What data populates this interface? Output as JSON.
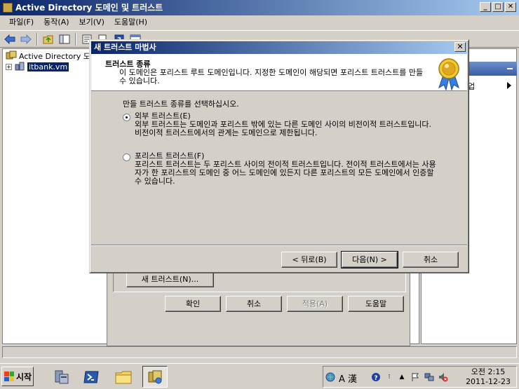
{
  "app": {
    "title": "Active Directory 도메인 및 트러스트",
    "menu": [
      "파일(F)",
      "동작(A)",
      "보기(V)",
      "도움말(H)"
    ]
  },
  "tree": {
    "root": "Active Directory 도메",
    "child": "itbank.vm"
  },
  "actions": {
    "partial_label": "업"
  },
  "properties_dialog": {
    "new_trust_button": "새 트러스트(N)...",
    "ok": "확인",
    "cancel": "취소",
    "apply": "적용(A)",
    "help": "도움말"
  },
  "wizard": {
    "title": "새 트러스트 마법사",
    "header_title": "트러스트 종류",
    "header_desc": "이 도메인은 포리스트 루트 도메인입니다. 지정한 도메인이 해당되면 포리스트 트러스트를 만들 수 있습니다.",
    "intro": "만들 트러스트 종류를 선택하십시오.",
    "options": [
      {
        "label": "외부 트러스트(E)",
        "desc": "외부 트러스트는 도메인과 포리스트 밖에 있는 다른 도메인 사이의 비전이적 트러스트입니다. 비전이적 트러스트에서의 관계는 도메인으로 제한됩니다.",
        "selected": true
      },
      {
        "label": "포리스트 트러스트(F)",
        "desc": "포리스트 트러스트는 두 포리스트 사이의 전이적 트러스트입니다. 전이적 트러스트에서는 사용자가 한 포리스트의 도메인 중 어느 도메인에 있든지 다른 포리스트의 모든 도메인에서 인증할 수 있습니다.",
        "selected": false
      }
    ],
    "back": "< 뒤로(B)",
    "next": "다음(N) >",
    "cancel": "취소"
  },
  "taskbar": {
    "start": "시작",
    "tray_text": "A 漢",
    "clock_time": "오전 2:15",
    "clock_date": "2011-12-23"
  }
}
